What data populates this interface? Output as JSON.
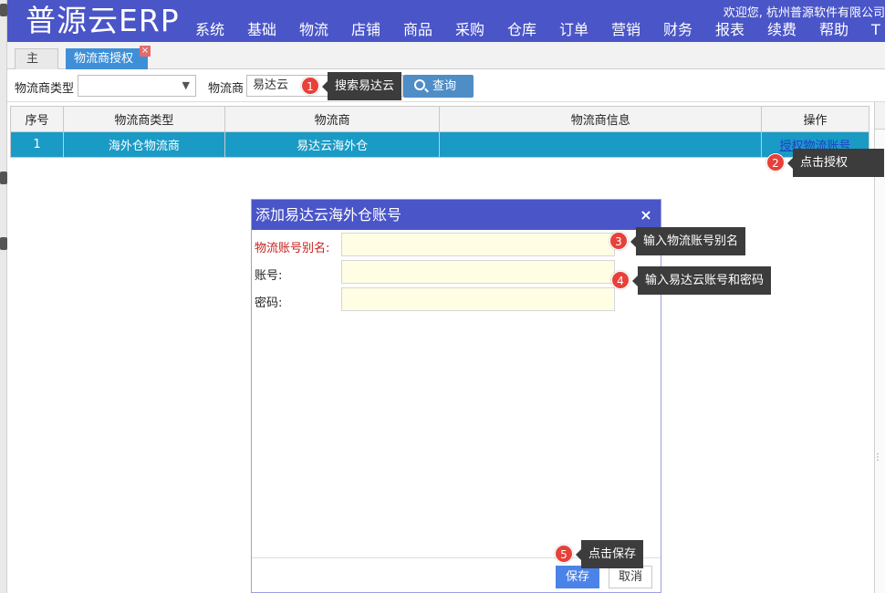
{
  "app": {
    "logo": "普源云ERP",
    "welcome": "欢迎您, 杭州普源软件有限公司",
    "nav": [
      "系统",
      "基础",
      "物流",
      "店铺",
      "商品",
      "采购",
      "仓库",
      "订单",
      "营销",
      "财务",
      "报表",
      "续费",
      "帮助",
      "T"
    ]
  },
  "tabs": [
    {
      "label": "主页"
    },
    {
      "label": "物流商授权",
      "close": "×"
    }
  ],
  "search": {
    "type_label": "物流商类型",
    "type_value": "",
    "chevron": "chevron-down-icon",
    "carrier_label": "物流商",
    "carrier_value": "易达云",
    "query_label": "查询",
    "query_icon": "search-icon"
  },
  "table": {
    "columns": [
      "序号",
      "物流商类型",
      "物流商",
      "物流商信息",
      "操作"
    ],
    "rows": [
      {
        "index": "1",
        "type": "海外仓物流商",
        "carrier": "易达云海外仓",
        "info": "",
        "action": "授权物流账号"
      }
    ]
  },
  "dialog": {
    "title": "添加易达云海外仓账号",
    "close": "×",
    "fields": [
      {
        "label": "物流账号别名:",
        "value": "",
        "required": true
      },
      {
        "label": "账号:",
        "value": "",
        "required": false
      },
      {
        "label": "密码:",
        "value": "",
        "required": false
      }
    ],
    "save": "保存",
    "cancel": "取消"
  },
  "callouts": [
    {
      "num": "1",
      "text": "搜索易达云"
    },
    {
      "num": "2",
      "text": "点击授权"
    },
    {
      "num": "3",
      "text": "输入物流账号别名"
    },
    {
      "num": "4",
      "text": "输入易达云账号和密码"
    },
    {
      "num": "5",
      "text": "点击保存"
    }
  ],
  "colors": {
    "header": "#4a55c8",
    "selected_row": "#1a9bc5",
    "callout_badge": "#e8403a",
    "callout_tip": "#3c3c3c",
    "input_fill": "#fffde4"
  }
}
